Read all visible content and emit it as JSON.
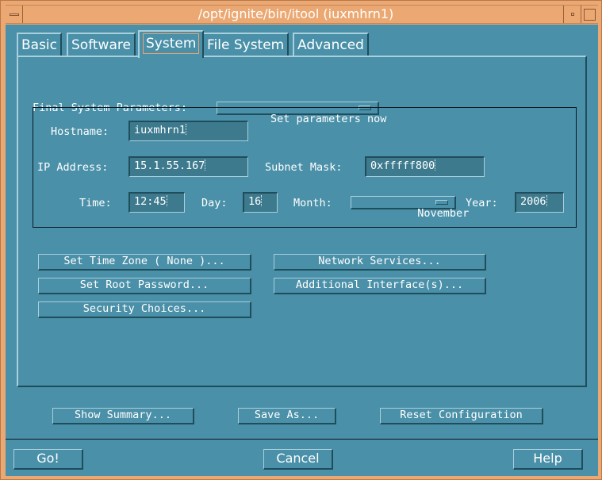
{
  "window": {
    "title": "/opt/ignite/bin/itool (iuxmhrn1)"
  },
  "tabs": [
    {
      "label": "Basic",
      "active": false
    },
    {
      "label": "Software",
      "active": false
    },
    {
      "label": "System",
      "active": true
    },
    {
      "label": "File System",
      "active": false
    },
    {
      "label": "Advanced",
      "active": false
    }
  ],
  "final_params": {
    "label": "Final System Parameters:",
    "selected": "Set parameters now"
  },
  "fields": {
    "hostname": {
      "label": "Hostname:",
      "value": "iuxmhrn1"
    },
    "ip_address": {
      "label": "IP Address:",
      "value": "15.1.55.167"
    },
    "subnet_mask": {
      "label": "Subnet Mask:",
      "value": "0xfffff800"
    },
    "time": {
      "label": "Time:",
      "value": "12:45"
    },
    "day": {
      "label": "Day:",
      "value": "16"
    },
    "month": {
      "label": "Month:",
      "selected": "November"
    },
    "year": {
      "label": "Year:",
      "value": "2006"
    }
  },
  "action_buttons": {
    "time_zone": "Set Time Zone ( None )...",
    "root_password": "Set Root Password...",
    "security": "Security Choices...",
    "network_services": "Network Services...",
    "additional_interfaces": "Additional Interface(s)..."
  },
  "footer_buttons": {
    "show_summary": "Show Summary...",
    "save_as": "Save As...",
    "reset": "Reset Configuration"
  },
  "dialog_buttons": {
    "go": "Go!",
    "cancel": "Cancel",
    "help": "Help"
  },
  "colors": {
    "background": "#4a90a8",
    "frame": "#eba872"
  }
}
